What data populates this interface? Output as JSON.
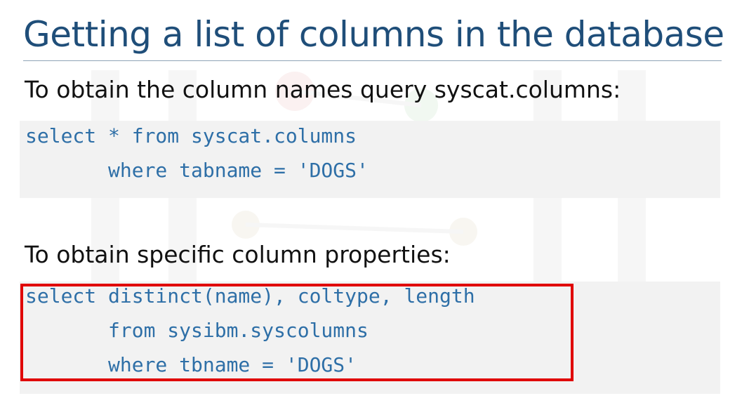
{
  "slide": {
    "title": "Getting a list of columns in the database",
    "accent_color": "#1f4e79",
    "code_color": "#2e6fa7",
    "highlight_color": "#e00000"
  },
  "section1": {
    "text": "To obtain the column names query syscat.columns:",
    "code_lines": [
      "select * from syscat.columns",
      "       where tabname = 'DOGS'"
    ]
  },
  "section2": {
    "text": "To obtain specific column properties:",
    "code_lines": [
      "select distinct(name), coltype, length",
      "       from sysibm.syscolumns",
      "       where tbname = 'DOGS'"
    ]
  }
}
